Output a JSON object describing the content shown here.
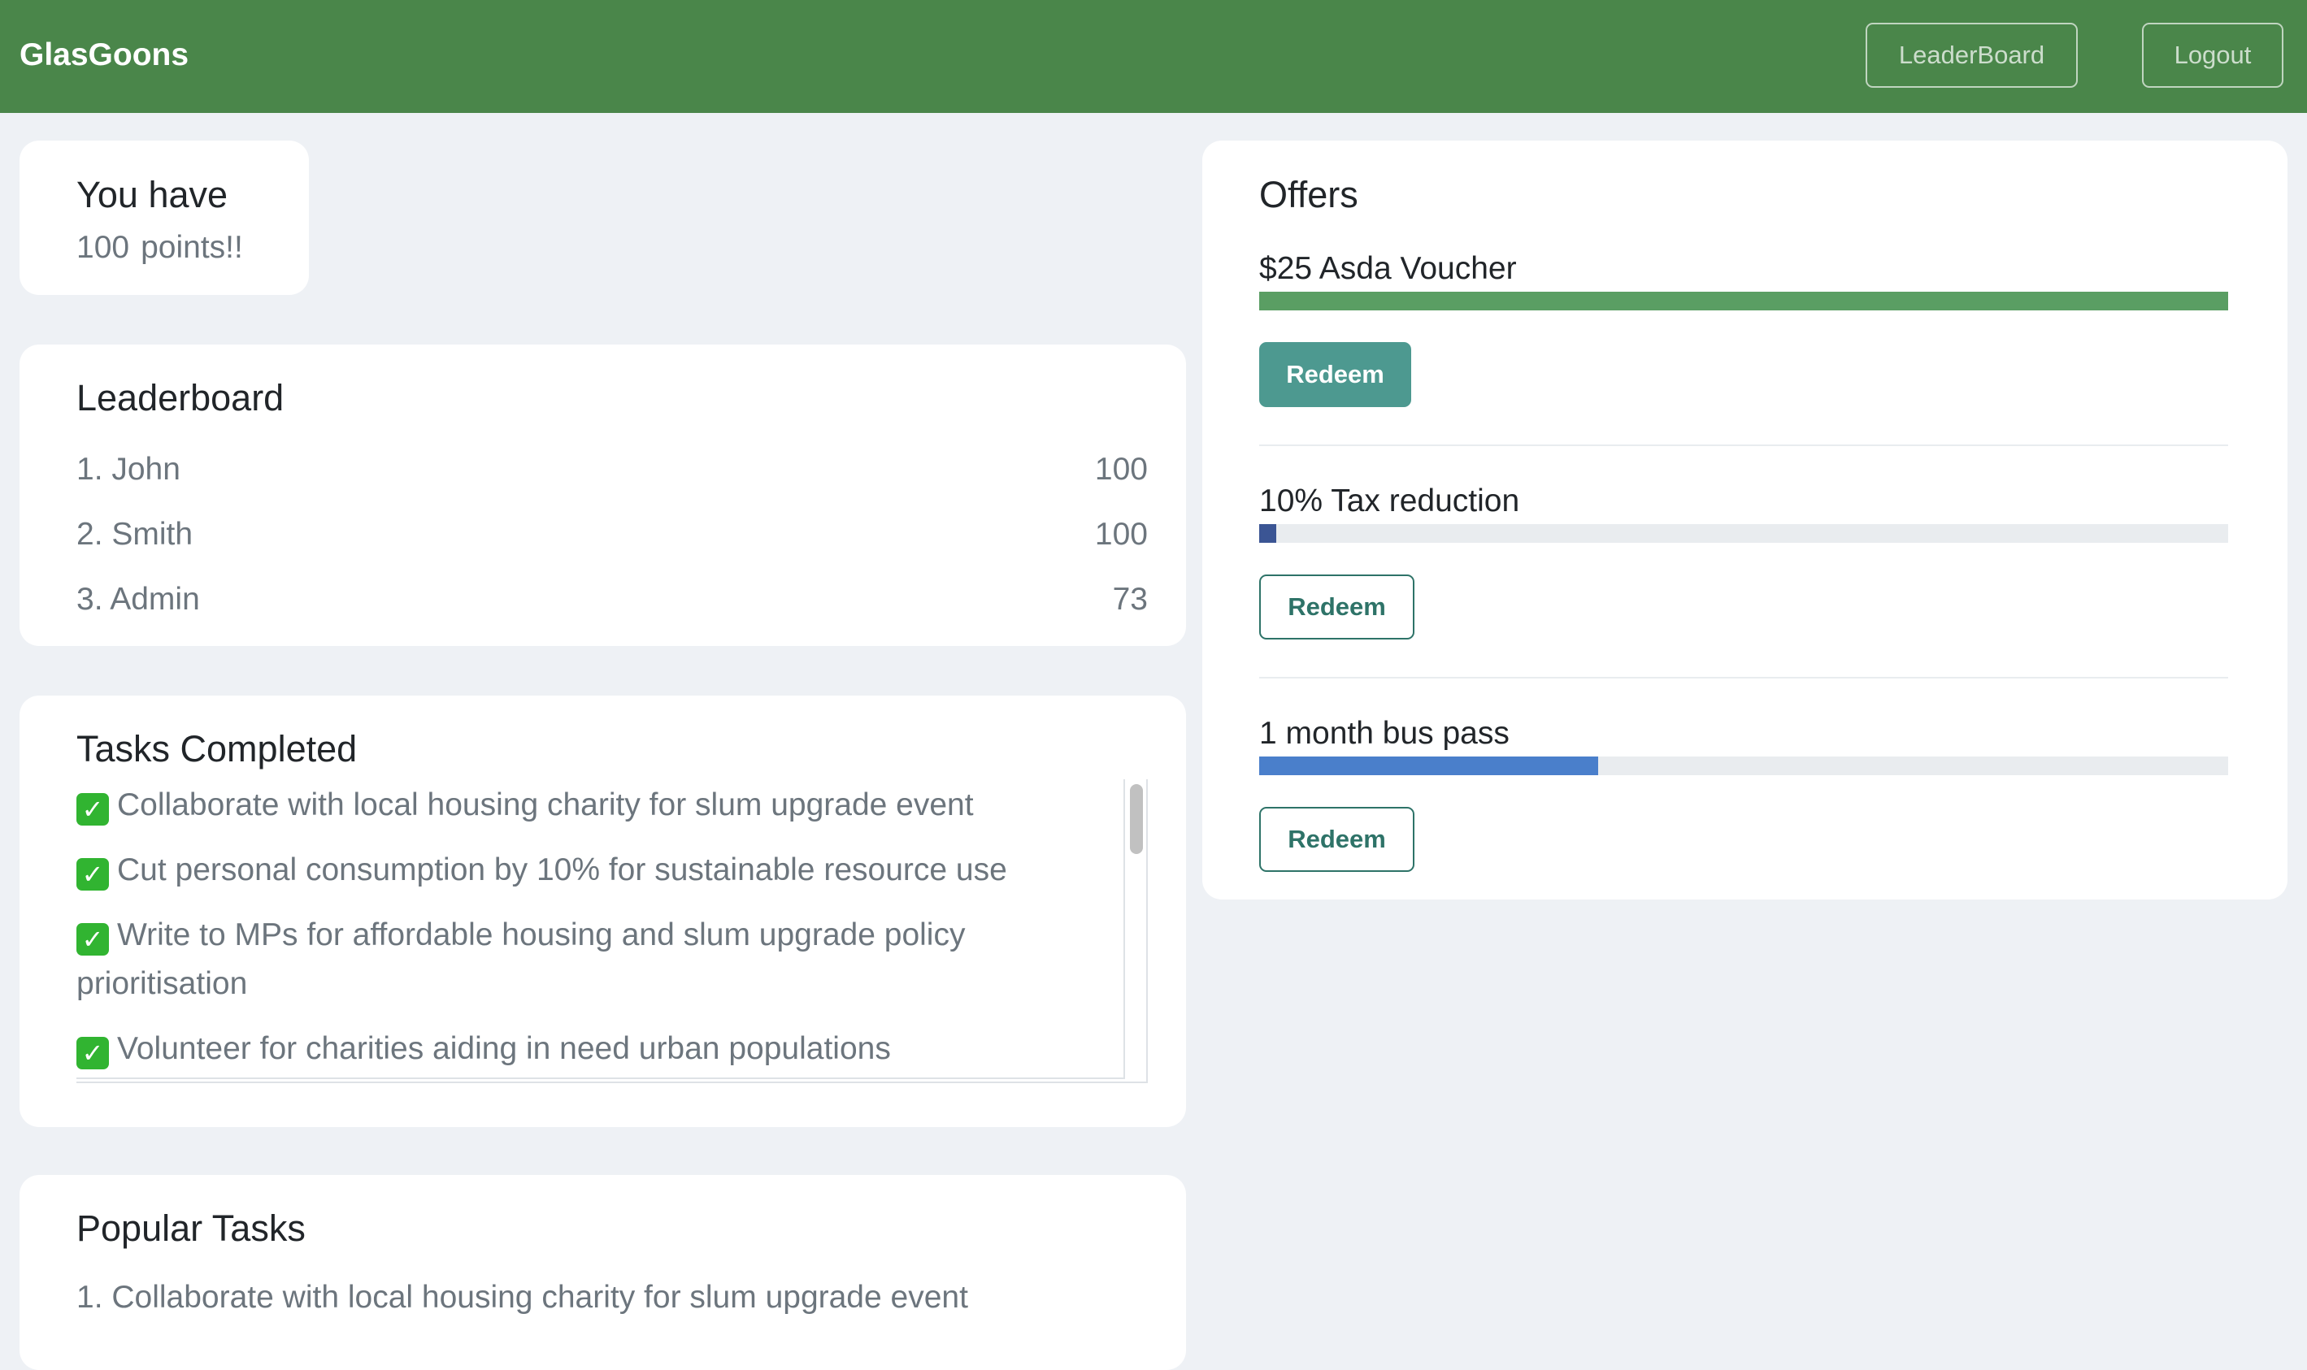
{
  "navbar": {
    "brand": "GlasGoons",
    "leaderboard_label": "LeaderBoard",
    "logout_label": "Logout",
    "background_color": "#4a864a"
  },
  "points": {
    "title": "You have",
    "value": "100",
    "suffix": "points!!"
  },
  "leaderboard": {
    "title": "Leaderboard",
    "rows": [
      {
        "name": "1. John",
        "score": "100"
      },
      {
        "name": "2. Smith",
        "score": "100"
      },
      {
        "name": "3. Admin",
        "score": "73"
      }
    ]
  },
  "tasks_completed": {
    "title": "Tasks Completed",
    "check_icon": "check-icon",
    "items": [
      "Collaborate with local housing charity for slum upgrade event",
      "Cut personal consumption by 10% for sustainable resource use",
      "Write to MPs for affordable housing and slum upgrade policy prioritisation",
      "Volunteer for charities aiding in need urban populations"
    ]
  },
  "popular_tasks": {
    "title": "Popular Tasks",
    "items": [
      "1. Collaborate with local housing charity for slum upgrade event"
    ]
  },
  "offers": {
    "title": "Offers",
    "items": [
      {
        "title": "$25 Asda Voucher",
        "progress": 1.0,
        "bar_color": "#5a9e63",
        "redeem_label": "Redeem",
        "redeem_style": "solid"
      },
      {
        "title": "10% Tax reduction",
        "progress": 0.018,
        "bar_color": "#3b5594",
        "redeem_label": "Redeem",
        "redeem_style": "outline"
      },
      {
        "title": "1 month bus pass",
        "progress": 0.35,
        "bar_color": "#4a7fcb",
        "redeem_label": "Redeem",
        "redeem_style": "outline"
      }
    ]
  }
}
